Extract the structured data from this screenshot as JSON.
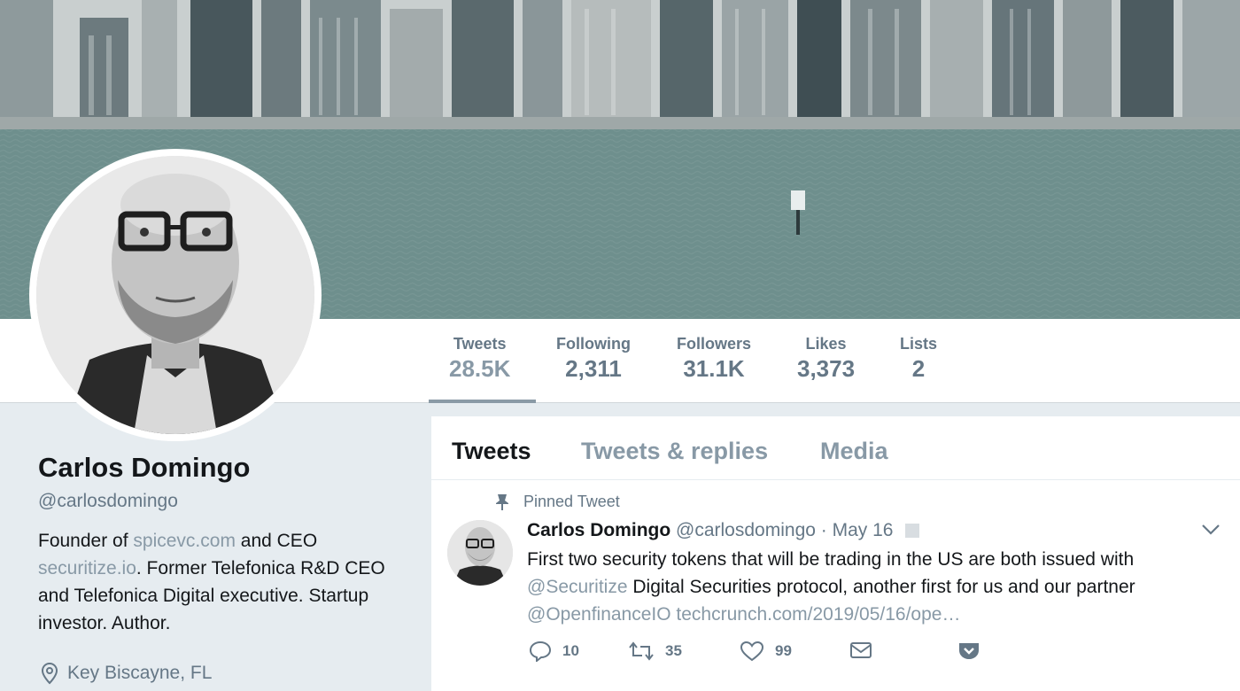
{
  "nav": {
    "stats": [
      {
        "label": "Tweets",
        "value": "28.5K"
      },
      {
        "label": "Following",
        "value": "2,311"
      },
      {
        "label": "Followers",
        "value": "31.1K"
      },
      {
        "label": "Likes",
        "value": "3,373"
      },
      {
        "label": "Lists",
        "value": "2"
      }
    ]
  },
  "profile": {
    "name": "Carlos Domingo",
    "handle": "@carlosdomingo",
    "bio": {
      "t1": "Founder of ",
      "link1": "spicevc.com",
      "t2": " and CEO ",
      "link2": "securitize.io",
      "t3": ". Former Telefonica R&D CEO and Telefonica Digital executive. Startup investor. Author."
    },
    "location": "Key Biscayne, FL"
  },
  "timeline": {
    "tabs": [
      "Tweets",
      "Tweets & replies",
      "Media"
    ],
    "active_tab": "Tweets"
  },
  "tweet": {
    "pinned_label": "Pinned Tweet",
    "name": "Carlos Domingo",
    "handle": "@carlosdomingo",
    "date": "· May 16",
    "text": {
      "t1": "First two security tokens that will be trading in the US are both issued with ",
      "mention1": "@Securitize",
      "t2": " Digital Securities protocol, another first for us and our partner ",
      "mention2": "@OpenfinanceIO",
      "t3": " ",
      "link": "techcrunch.com/2019/05/16/ope…"
    },
    "replies": "10",
    "retweets": "35",
    "likes": "99"
  },
  "icons": {
    "location": "map-pin-icon",
    "pin": "pushpin-icon",
    "reply": "reply-icon",
    "retweet": "retweet-icon",
    "like": "heart-icon",
    "dm": "envelope-icon",
    "analytics": "pocket-icon",
    "caret": "chevron-down-icon"
  },
  "colors": {
    "link": "#8899a6",
    "muted": "#657786",
    "background": "#e6ecf0"
  }
}
